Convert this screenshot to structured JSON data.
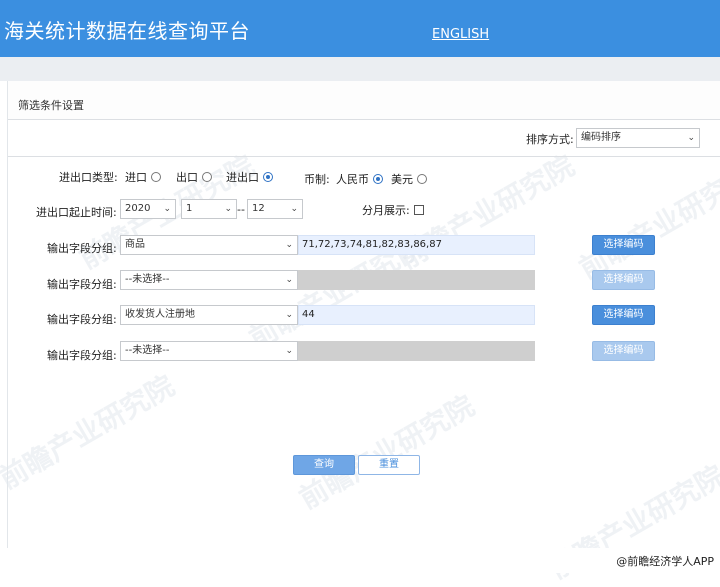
{
  "header": {
    "title": "海关统计数据在线查询平台",
    "english_link": "ENGLISH"
  },
  "panel": {
    "heading": "筛选条件设置",
    "sort": {
      "label": "排序方式:",
      "value": "编码排序"
    }
  },
  "filters": {
    "trade_type": {
      "label": "进出口类型:",
      "options": [
        {
          "label": "进口",
          "checked": false
        },
        {
          "label": "出口",
          "checked": false
        },
        {
          "label": "进出口",
          "checked": true
        }
      ]
    },
    "currency": {
      "label": "币制:",
      "options": [
        {
          "label": "人民币",
          "checked": true
        },
        {
          "label": "美元",
          "checked": false
        }
      ]
    },
    "period": {
      "label": "进出口起止时间:",
      "year": "2020",
      "start_month": "1",
      "separator": "--",
      "end_month": "12",
      "monthly_label": "分月展示:",
      "monthly_checked": false
    }
  },
  "groups": [
    {
      "label": "输出字段分组:",
      "select": "商品",
      "codes": "71,72,73,74,81,82,83,86,87",
      "enabled": true,
      "button": "选择编码"
    },
    {
      "label": "输出字段分组:",
      "select": "--未选择--",
      "codes": "",
      "enabled": false,
      "button": "选择编码"
    },
    {
      "label": "输出字段分组:",
      "select": "收发货人注册地",
      "codes": "44",
      "enabled": true,
      "button": "选择编码"
    },
    {
      "label": "输出字段分组:",
      "select": "--未选择--",
      "codes": "",
      "enabled": false,
      "button": "选择编码"
    }
  ],
  "actions": {
    "query": "查询",
    "reset": "重置"
  },
  "watermark": "前瞻产业研究院",
  "credit": "@前瞻经济学人APP",
  "icons": {
    "dropdown": "chevron-down-icon"
  },
  "colors": {
    "header": "#3b8fe0",
    "primary": "#4a8fdc",
    "disabled_input": "#cfcfcf"
  }
}
